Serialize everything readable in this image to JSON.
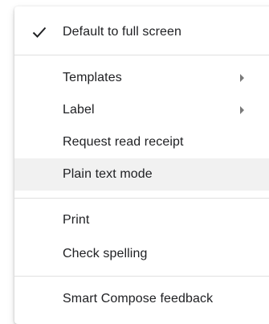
{
  "menu": {
    "items": [
      {
        "id": "default-full-screen",
        "label": "Default to full screen",
        "checked": true,
        "icon": "check-icon"
      },
      {
        "id": "templates",
        "label": "Templates",
        "submenu": true,
        "icon": "chevron-right-icon"
      },
      {
        "id": "label",
        "label": "Label",
        "submenu": true,
        "icon": "chevron-right-icon"
      },
      {
        "id": "request-read-receipt",
        "label": "Request read receipt"
      },
      {
        "id": "plain-text-mode",
        "label": "Plain text mode",
        "hovered": true
      },
      {
        "id": "print",
        "label": "Print"
      },
      {
        "id": "check-spelling",
        "label": "Check spelling"
      },
      {
        "id": "smart-compose-feedback",
        "label": "Smart Compose feedback"
      }
    ]
  },
  "colors": {
    "text": "#202124",
    "icon": "#202124",
    "submenu_arrow": "#7a7a7a",
    "hover_background": "#f1f1f1",
    "divider": "#e0e0e0",
    "background": "#ffffff"
  }
}
